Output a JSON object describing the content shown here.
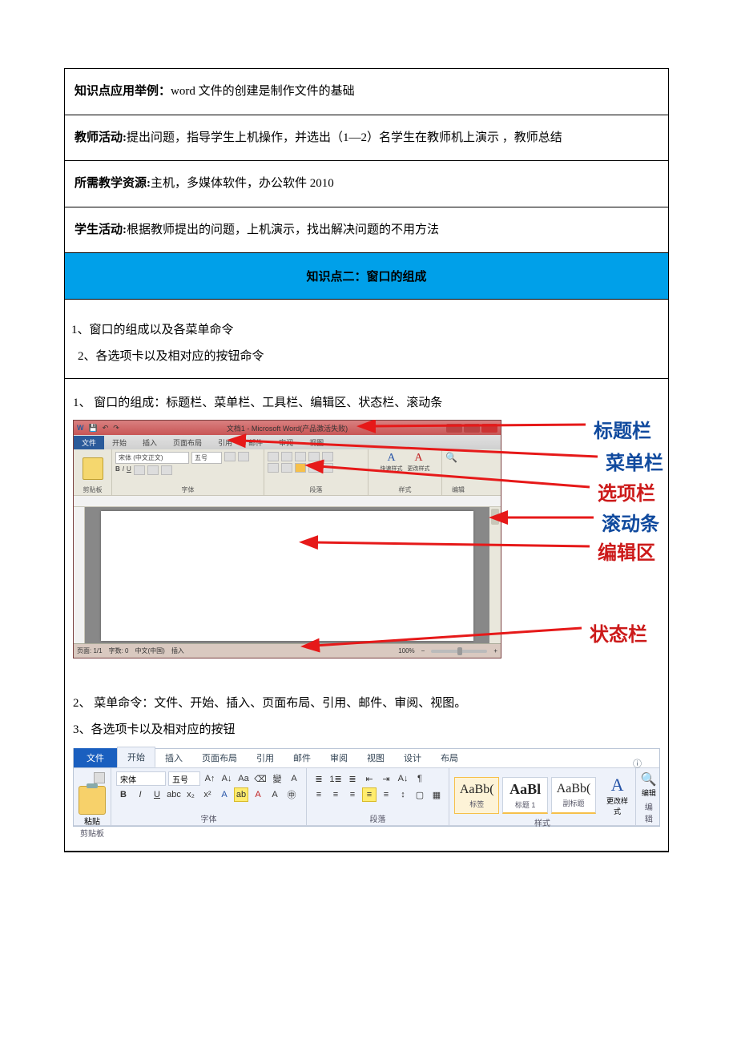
{
  "row1": {
    "label": "知识点应用举例：",
    "text": "word 文件的创建是制作文件的基础"
  },
  "row2": {
    "label": "教师活动:",
    "text": "提出问题，指导学生上机操作，并选出（1—2）名学生在教师机上演示 ，教师总结"
  },
  "row3": {
    "label": "所需教学资源:",
    "text": "主机，多媒体软件，办公软件 2010"
  },
  "row4": {
    "label": "学生活动:",
    "text": "根据教师提出的问题，上机演示，找出解决问题的不用方法"
  },
  "blue": "知识点二：窗口的组成",
  "intro1": "1、窗口的组成以及各菜单命令",
  "intro2": "2、各选项卡以及相对应的按钮命令",
  "sec1": "1、 窗口的组成：标题栏、菜单栏、工具栏、编辑区、状态栏、滚动条",
  "word": {
    "title": "文档1 - Microsoft Word(产品激活失败)",
    "tabs": [
      "文件",
      "开始",
      "插入",
      "页面布局",
      "引用",
      "邮件",
      "审阅",
      "视图"
    ],
    "font": "宋体 (中文正文)",
    "size": "五号",
    "groups": {
      "clip": "剪贴板",
      "font": "字体",
      "para": "段落",
      "styles": "样式",
      "edit": "编辑"
    },
    "quick": "快速样式",
    "change": "更改样式",
    "status": {
      "page": "页面: 1/1",
      "words": "字数: 0",
      "lang": "中文(中国)",
      "mode": "插入",
      "zoom": "100%"
    }
  },
  "anno": {
    "title": "标题栏",
    "menu": "菜单栏",
    "option": "选项栏",
    "scroll": "滚动条",
    "edit": "编辑区",
    "status": "状态栏"
  },
  "sec2": "2、 菜单命令：文件、开始、插入、页面布局、引用、邮件、审阅、视图。",
  "sec3": "3、各选项卡以及相对应的按钮",
  "ribbon2": {
    "tabs": [
      "文件",
      "开始",
      "插入",
      "页面布局",
      "引用",
      "邮件",
      "审阅",
      "视图",
      "设计",
      "布局"
    ],
    "paste": "粘贴",
    "font": "宋体",
    "size": "五号",
    "groups": {
      "clip": "剪贴板",
      "font": "字体",
      "para": "段落",
      "styles": "样式",
      "edit": "编辑"
    },
    "styles": [
      {
        "aa": "AaBb(",
        "name": "标签"
      },
      {
        "aa": "AaBl",
        "name": "标题 1"
      },
      {
        "aa": "AaBb(",
        "name": "副标题"
      }
    ],
    "change": "更改样式",
    "edit": "编辑"
  }
}
